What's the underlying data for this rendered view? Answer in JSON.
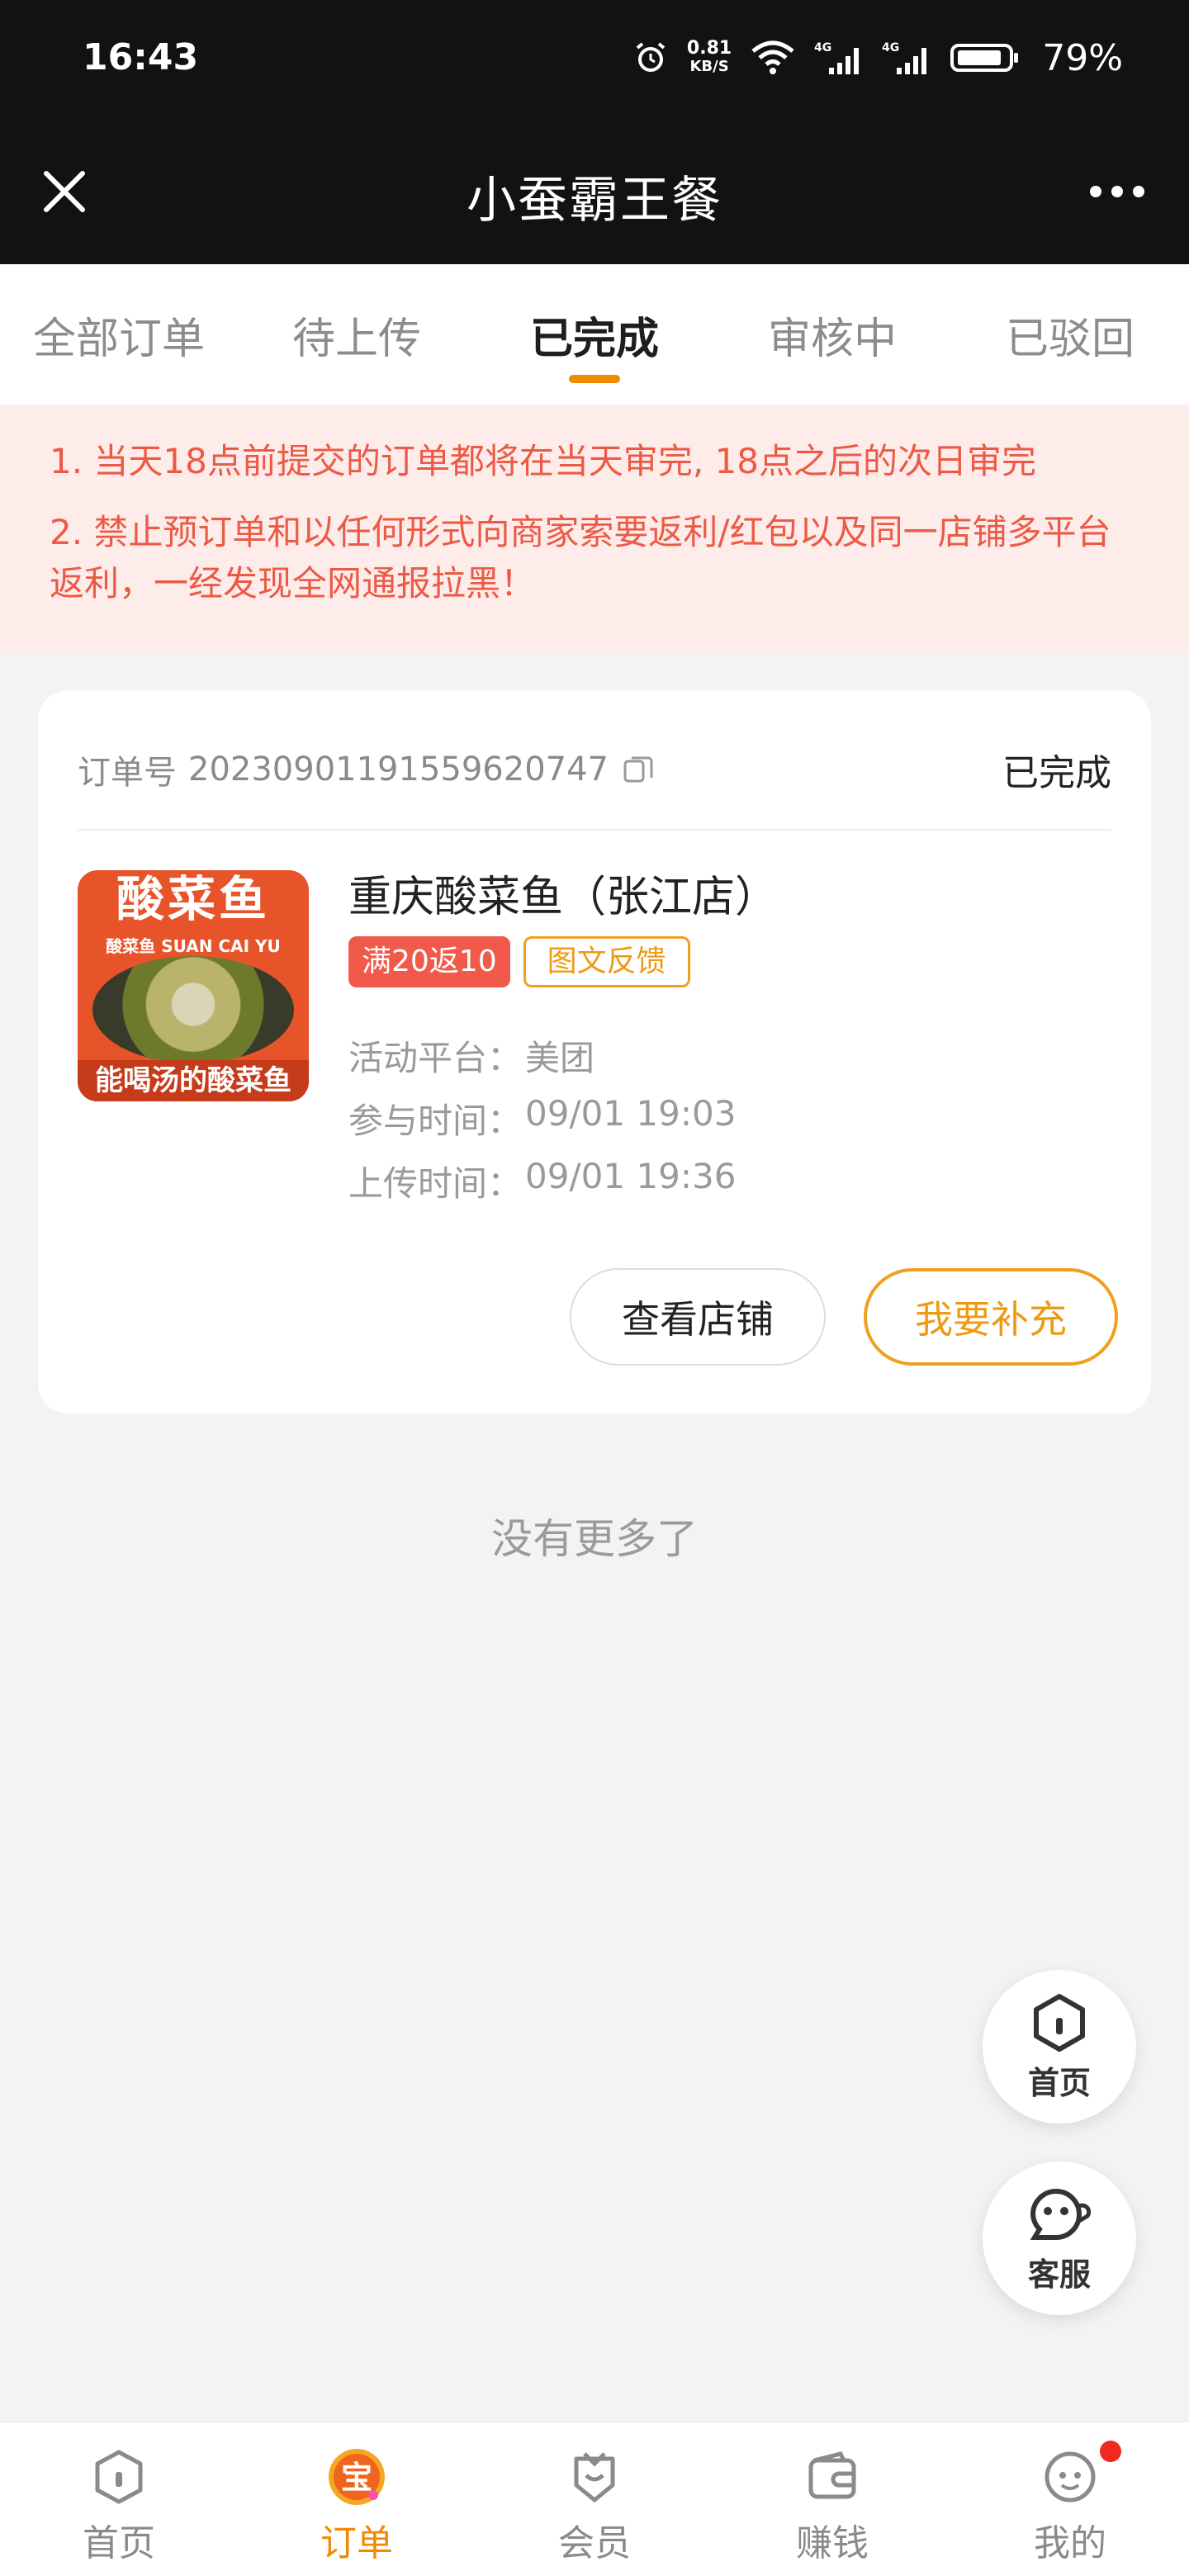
{
  "status_bar": {
    "time": "16:43",
    "net_speed_value": "0.81",
    "net_speed_unit": "KB/S",
    "network_1": "4G",
    "network_2": "4G",
    "battery": "79%"
  },
  "header": {
    "title": "小蚕霸王餐",
    "close_icon": "close-icon",
    "more_icon": "more-icon"
  },
  "tabs": [
    {
      "label": "全部订单",
      "active": false
    },
    {
      "label": "待上传",
      "active": false
    },
    {
      "label": "已完成",
      "active": true
    },
    {
      "label": "审核中",
      "active": false
    },
    {
      "label": "已驳回",
      "active": false
    }
  ],
  "notice": {
    "line1": "1. 当天18点前提交的订单都将在当天审完, 18点之后的次日审完",
    "line2": "2. 禁止预订单和以任何形式向商家索要返利/红包以及同一店铺多平台返利，一经发现全网通报拉黑！"
  },
  "order": {
    "order_no_label": "订单号",
    "order_no": "2023090119155962074​7",
    "status": "已完成",
    "thumbnail": {
      "title": "酸菜鱼",
      "subtitle": "酸菜鱼 SUAN CAI YU",
      "bottom_text": "能喝汤的酸菜鱼"
    },
    "shop_name": "重庆酸菜鱼（张江店）",
    "tag_reward": "满20返10",
    "tag_type": "图文反馈",
    "platform_label": "活动平台：",
    "platform": "美团",
    "join_time_label": "参与时间：",
    "join_time": "09/01 19:03",
    "upload_time_label": "上传时间：",
    "upload_time": "09/01 19:36",
    "view_shop_button": "查看店铺",
    "supplement_button": "我要补充"
  },
  "no_more": "没有更多了",
  "floating": {
    "home_label": "首页",
    "service_label": "客服"
  },
  "bottom_nav": [
    {
      "label": "首页",
      "icon": "home-icon",
      "active": false
    },
    {
      "label": "订单",
      "icon": "order-icon",
      "active": true
    },
    {
      "label": "会员",
      "icon": "member-icon",
      "active": false
    },
    {
      "label": "赚钱",
      "icon": "wallet-icon",
      "active": false
    },
    {
      "label": "我的",
      "icon": "profile-icon",
      "active": false
    }
  ],
  "colors": {
    "accent": "#f08a00",
    "notice_text": "#ec5a45",
    "notice_bg": "#fdecea",
    "badge_red": "#f0281e",
    "header_bg": "#121212"
  }
}
